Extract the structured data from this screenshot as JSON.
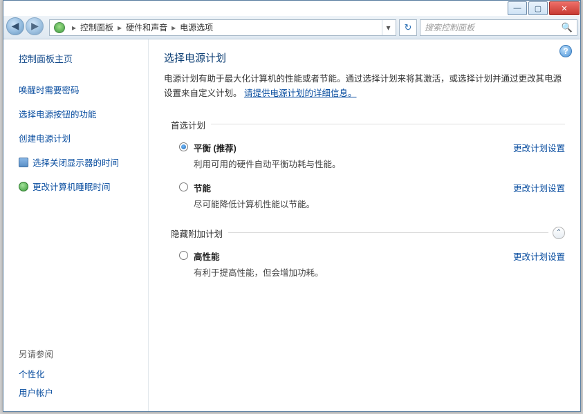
{
  "titlebar": {
    "min": "—",
    "max": "▢",
    "close": "✕"
  },
  "address": {
    "crumbs": [
      "控制面板",
      "硬件和声音",
      "电源选项"
    ],
    "dropdown_glyph": "▾",
    "refresh_glyph": "↻"
  },
  "search": {
    "placeholder": "搜索控制面板",
    "icon": "🔍"
  },
  "sidebar": {
    "home": "控制面板主页",
    "links": {
      "wake_password": "唤醒时需要密码",
      "button_action": "选择电源按钮的功能",
      "create_plan": "创建电源计划",
      "display_off": "选择关闭显示器的时间",
      "sleep_time": "更改计算机睡眠时间"
    },
    "see_also": "另请参阅",
    "personalization": "个性化",
    "user_accounts": "用户帐户"
  },
  "main": {
    "help_glyph": "?",
    "title": "选择电源计划",
    "desc_pre": "电源计划有助于最大化计算机的性能或者节能。通过选择计划来将其激活，或选择计划并通过更改其电源设置来自定义计划。",
    "desc_link": "请提供电源计划的详细信息。",
    "preferred_label": "首选计划",
    "hidden_label": "隐藏附加计划",
    "expander_glyph": "⌃",
    "change_label": "更改计划设置",
    "plans": {
      "balanced": {
        "name": "平衡",
        "rec": " (推荐)",
        "sub": "利用可用的硬件自动平衡功耗与性能。"
      },
      "saver": {
        "name": "节能",
        "sub": "尽可能降低计算机性能以节能。"
      },
      "high": {
        "name": "高性能",
        "sub": "有利于提高性能，但会增加功耗。"
      }
    }
  }
}
